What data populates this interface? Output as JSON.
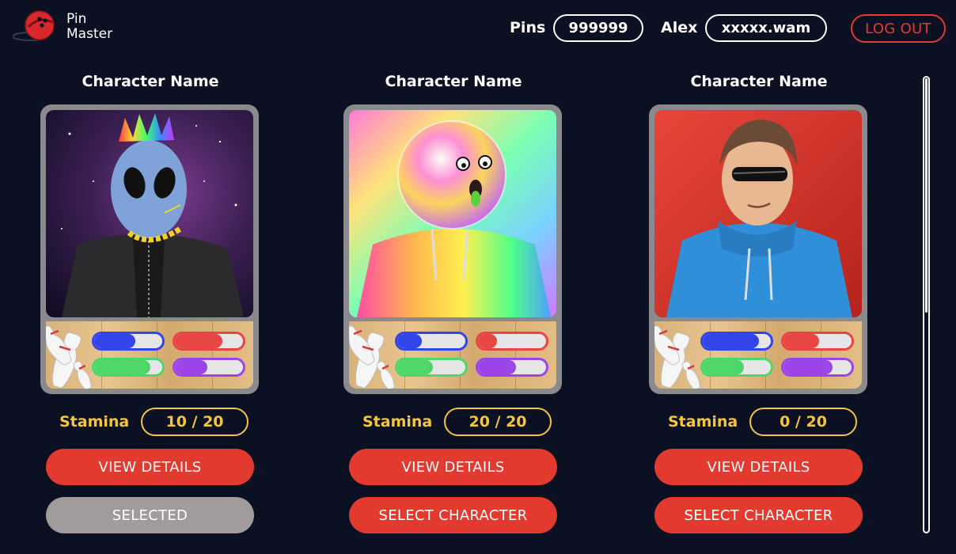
{
  "header": {
    "logo_line1": "Pin",
    "logo_line2": "Master",
    "pins_label": "Pins",
    "pins_value": "999999",
    "user_name": "Alex",
    "wallet": "xxxxx.wam",
    "logout_label": "LOG OUT"
  },
  "characters": [
    {
      "name": "Character Name",
      "stamina_label": "Stamina",
      "stamina": "10 / 20",
      "view_label": "VIEW DETAILS",
      "select_label": "SELECTED",
      "selected": true,
      "stats": {
        "blue": 0.6,
        "red": 0.7,
        "green": 0.83,
        "purple": 0.48
      }
    },
    {
      "name": "Character Name",
      "stamina_label": "Stamina",
      "stamina": "20 / 20",
      "view_label": "VIEW DETAILS",
      "select_label": "SELECT CHARACTER",
      "selected": false,
      "stats": {
        "blue": 0.36,
        "red": 0.28,
        "green": 0.52,
        "purple": 0.56
      }
    },
    {
      "name": "Character Name",
      "stamina_label": "Stamina",
      "stamina": "0 / 20",
      "view_label": "VIEW DETAILS",
      "select_label": "SELECT CHARACTER",
      "selected": false,
      "stats": {
        "blue": 0.82,
        "red": 0.52,
        "green": 0.6,
        "purple": 0.72
      }
    }
  ],
  "colors": {
    "background": "#0c1023",
    "accent_red": "#e23a2f",
    "stamina_yellow": "#f4c63d",
    "selected_grey": "#a29b9b",
    "stat_blue": "#3345e8",
    "stat_red": "#e84545",
    "stat_green": "#4fd66b",
    "stat_purple": "#9b45e8"
  },
  "icons": [
    "bowling-ball-logo-icon",
    "bowling-pins-icon"
  ]
}
